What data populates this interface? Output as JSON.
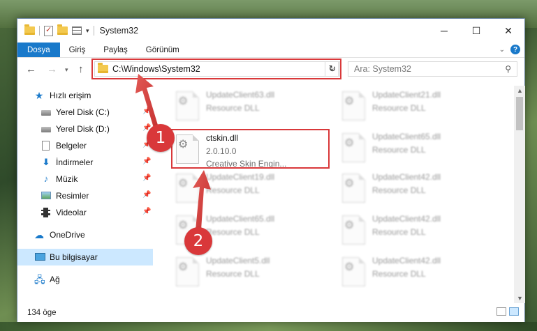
{
  "window": {
    "title": "System32",
    "minimize_label": "─",
    "maximize_label": "☐",
    "close_label": "✕"
  },
  "ribbon": {
    "tabs": [
      {
        "label": "Dosya"
      },
      {
        "label": "Giriş"
      },
      {
        "label": "Paylaş"
      },
      {
        "label": "Görünüm"
      }
    ],
    "help_label": "?"
  },
  "nav": {
    "address": "C:\\Windows\\System32",
    "search_placeholder": "Ara: System32"
  },
  "sidebar": {
    "items": [
      {
        "label": "Hızlı erişim",
        "icon": "star-icon",
        "pinned": false
      },
      {
        "label": "Yerel Disk (C:)",
        "icon": "drive-icon",
        "pinned": true
      },
      {
        "label": "Yerel Disk (D:)",
        "icon": "drive-icon",
        "pinned": true
      },
      {
        "label": "Belgeler",
        "icon": "document-icon",
        "pinned": true
      },
      {
        "label": "İndirmeler",
        "icon": "download-icon",
        "pinned": true
      },
      {
        "label": "Müzik",
        "icon": "music-icon",
        "pinned": true
      },
      {
        "label": "Resimler",
        "icon": "pictures-icon",
        "pinned": true
      },
      {
        "label": "Videolar",
        "icon": "videos-icon",
        "pinned": true
      },
      {
        "label": "OneDrive",
        "icon": "cloud-icon",
        "pinned": false
      },
      {
        "label": "Bu bilgisayar",
        "icon": "computer-icon",
        "pinned": false,
        "selected": true
      },
      {
        "label": "Ağ",
        "icon": "network-icon",
        "pinned": false
      }
    ]
  },
  "files": {
    "highlighted": {
      "name": "ctskin.dll",
      "version": "2.0.10.0",
      "description": "Creative Skin Engin..."
    },
    "left_column": [
      {
        "name": "UpdateClient63.dll",
        "type": "Resource DLL"
      },
      {
        "name": "UpdateClient19.dll",
        "type": "Resource DLL"
      },
      {
        "name": "UpdateClient65.dll",
        "type": "Resource DLL"
      },
      {
        "name": "UpdateClient5.dll",
        "type": "Resource DLL"
      }
    ],
    "right_column": [
      {
        "name": "UpdateClient21.dll",
        "type": "Resource DLL"
      },
      {
        "name": "UpdateClient65.dll",
        "type": "Resource DLL"
      },
      {
        "name": "UpdateClient42.dll",
        "type": "Resource DLL"
      },
      {
        "name": "UpdateClient42.dll",
        "type": "Resource DLL"
      },
      {
        "name": "UpdateClient42.dll",
        "type": "Resource DLL"
      }
    ]
  },
  "status": {
    "item_count": "134 öge"
  },
  "annotations": [
    {
      "number": "1",
      "color": "#d9383a"
    },
    {
      "number": "2",
      "color": "#d9383a"
    }
  ],
  "colors": {
    "accent": "#1979ca",
    "highlight": "#d9383a",
    "selected": "#cce8ff"
  }
}
